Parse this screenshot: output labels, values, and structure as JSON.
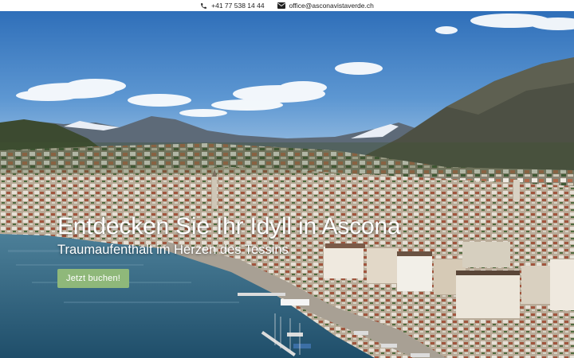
{
  "topbar": {
    "phone": {
      "icon": "phone-icon",
      "text": "+41 77 538 14 44"
    },
    "email": {
      "icon": "envelope-icon",
      "text": "office@asconavistaverde.ch"
    }
  },
  "hero": {
    "title": "Entdecken Sie Ihr Idyll in Ascona",
    "subtitle": "Traumaufenthalt im Herzen des Tessins",
    "cta_label": "Jetzt buchen!",
    "background": "aerial-photo-ascona-lakefront"
  },
  "colors": {
    "cta": "#8fb87a",
    "sky": "#3f7fc4",
    "lake": "#3a6f8c"
  }
}
